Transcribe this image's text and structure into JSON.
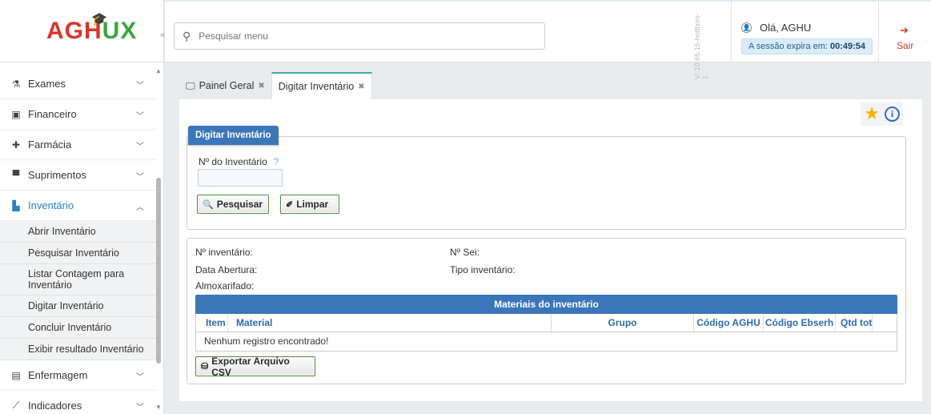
{
  "app": {
    "logo_left": "AGH",
    "logo_right": "X",
    "logo_u": "U"
  },
  "sidebar": {
    "collapse_glyph": "«",
    "items": [
      {
        "label": "Exames",
        "icon": "flask-icon"
      },
      {
        "label": "Financeiro",
        "icon": "money-icon"
      },
      {
        "label": "Farmácia",
        "icon": "pharmacy-cross-icon"
      },
      {
        "label": "Suprimentos",
        "icon": "box-icon"
      },
      {
        "label": "Inventário",
        "icon": "inventory-icon"
      },
      {
        "label": "Enfermagem",
        "icon": "list-icon"
      },
      {
        "label": "Indicadores",
        "icon": "chart-line-icon"
      }
    ],
    "submenu": [
      "Abrir Inventário",
      "Pesquisar Inventário",
      "Listar Contagem para Inventário",
      "Digitar Inventário",
      "Concluir Inventário",
      "Exibir resultado Inventário"
    ]
  },
  "header": {
    "search_placeholder": "Pesquisar menu",
    "version": "V: 10.65.15-hotfixes-1",
    "greeting": "Olá, AGHU",
    "session_label": "A sessão expira em:",
    "session_time": "00:49:54",
    "logout_label": "Sair"
  },
  "tabs": [
    {
      "label": "Painel Geral",
      "active": false
    },
    {
      "label": "Digitar Inventário",
      "active": true
    }
  ],
  "form": {
    "legend": "Digitar Inventário",
    "inv_label": "Nº do Inventário",
    "help": "?",
    "inv_value": "",
    "search_btn": "Pesquisar",
    "clear_btn": "Limpar"
  },
  "details": {
    "num_inventario": "Nº inventário:",
    "num_sei": "Nº Sei:",
    "data_abertura": "Data Abertura:",
    "tipo_inventario": "Tipo inventário:",
    "almoxarifado": "Almoxarifado:"
  },
  "grid": {
    "title": "Materiais do inventário",
    "columns": [
      "Item",
      "Material",
      "Grupo",
      "Código AGHU",
      "Código Ebserh",
      "Qtd tota"
    ],
    "empty": "Nenhum registro encontrado!",
    "export_btn": "Exportar Arquivo CSV"
  },
  "colors": {
    "primary": "#3b76b9",
    "logo_red": "#d9342b",
    "logo_green": "#3aa63e",
    "active_menu": "#2e7fc2"
  }
}
